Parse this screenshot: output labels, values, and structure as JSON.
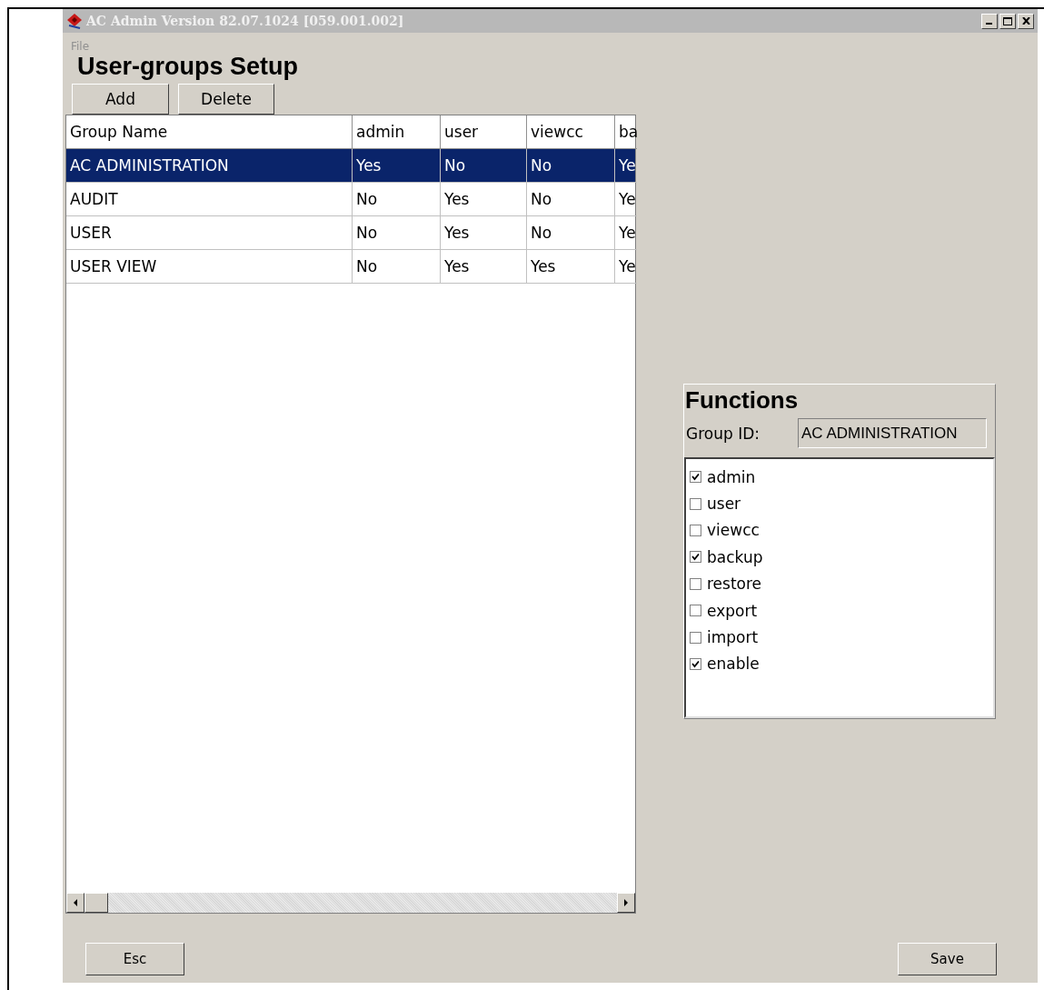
{
  "window": {
    "title": "AC Admin Version 82.07.1024 [059.001.002]"
  },
  "menu": [
    "File"
  ],
  "heading": "User-groups Setup",
  "toolbar": [
    "Add",
    "Delete"
  ],
  "table": {
    "columns": [
      "Group Name",
      "admin",
      "user",
      "viewcc",
      "ba"
    ],
    "rows": [
      {
        "cells": [
          "AC ADMINISTRATION",
          "Yes",
          "No",
          "No",
          "Ye"
        ],
        "selected": true
      },
      {
        "cells": [
          "AUDIT",
          "No",
          "Yes",
          "No",
          "Ye"
        ],
        "selected": false
      },
      {
        "cells": [
          "USER",
          "No",
          "Yes",
          "No",
          "Ye"
        ],
        "selected": false
      },
      {
        "cells": [
          "USER VIEW",
          "No",
          "Yes",
          "Yes",
          "Ye"
        ],
        "selected": false
      }
    ]
  },
  "functions": {
    "title": "Functions",
    "group_id_label": "Group ID:",
    "group_id": "AC ADMINISTRATION",
    "items": [
      {
        "label": "admin",
        "checked": true
      },
      {
        "label": "user",
        "checked": false
      },
      {
        "label": "viewcc",
        "checked": false
      },
      {
        "label": "backup",
        "checked": true
      },
      {
        "label": "restore",
        "checked": false
      },
      {
        "label": "export",
        "checked": false
      },
      {
        "label": "import",
        "checked": false
      },
      {
        "label": "enable",
        "checked": true
      }
    ]
  },
  "footer": [
    "Esc",
    "Save"
  ]
}
